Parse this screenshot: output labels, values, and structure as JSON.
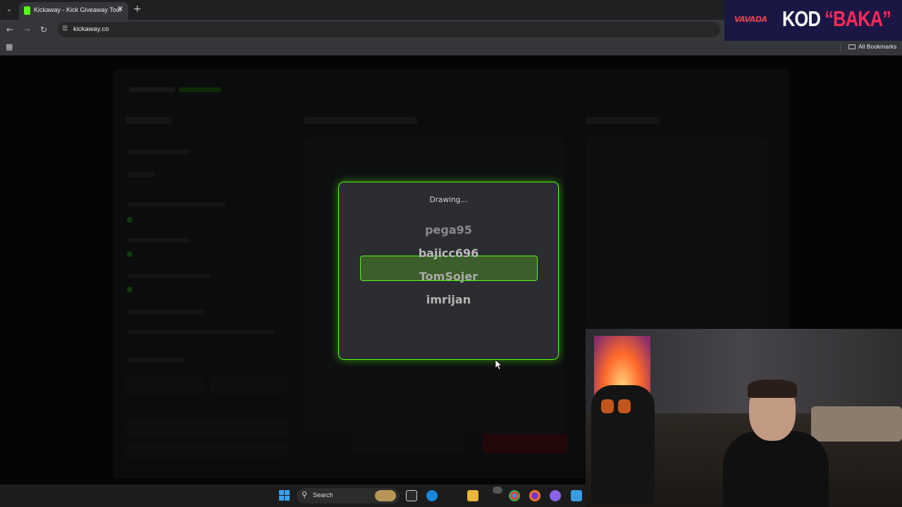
{
  "browser": {
    "tab_title": "Kickaway - Kick Giveaway Tool",
    "url": "kickaway.co",
    "bookmarks_label": "All Bookmarks",
    "icons": {
      "tab_menu": "chevron-down-icon",
      "close": "close-icon",
      "new_tab": "plus-icon",
      "back": "arrow-left-icon",
      "forward": "arrow-right-icon",
      "reload": "reload-icon",
      "site_info": "tune-icon",
      "apps": "grid-icon",
      "bookmarks_folder": "folder-icon"
    }
  },
  "modal": {
    "status": "Drawing...",
    "names": [
      "pega95",
      "bajicc696",
      "TomSojer",
      "imrijan"
    ],
    "selected_index": 2,
    "accent_color": "#53fc18"
  },
  "sponsor": {
    "brand": "VAVADA",
    "code_prefix": "KOD ",
    "code_value": "“BAKA”"
  },
  "taskbar": {
    "search_label": "Search",
    "icons": [
      "windows-icon",
      "search-icon",
      "task-view-icon",
      "edge-icon",
      "file-explorer-icon",
      "chrome-icon",
      "firefox-icon",
      "messenger-icon",
      "notepad-icon"
    ]
  }
}
